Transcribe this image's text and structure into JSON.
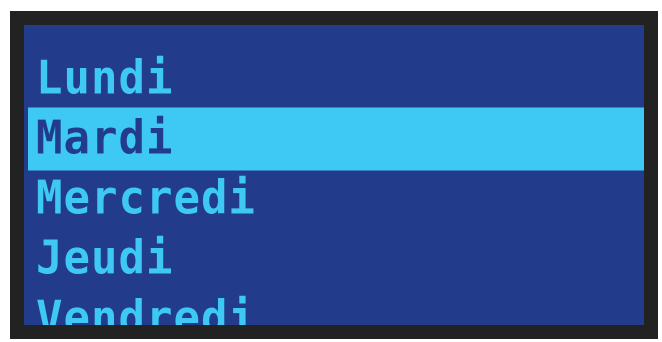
{
  "colors": {
    "frame": "#222222",
    "screen_bg": "#233b8b",
    "text": "#3ec8f4",
    "highlight_bg": "#3ec8f4",
    "highlight_text": "#233b8b"
  },
  "menu": {
    "selected_index": 1,
    "items": [
      {
        "label": "Lundi"
      },
      {
        "label": "Mardi"
      },
      {
        "label": "Mercredi"
      },
      {
        "label": "Jeudi"
      },
      {
        "label": "Vendredi"
      }
    ]
  }
}
